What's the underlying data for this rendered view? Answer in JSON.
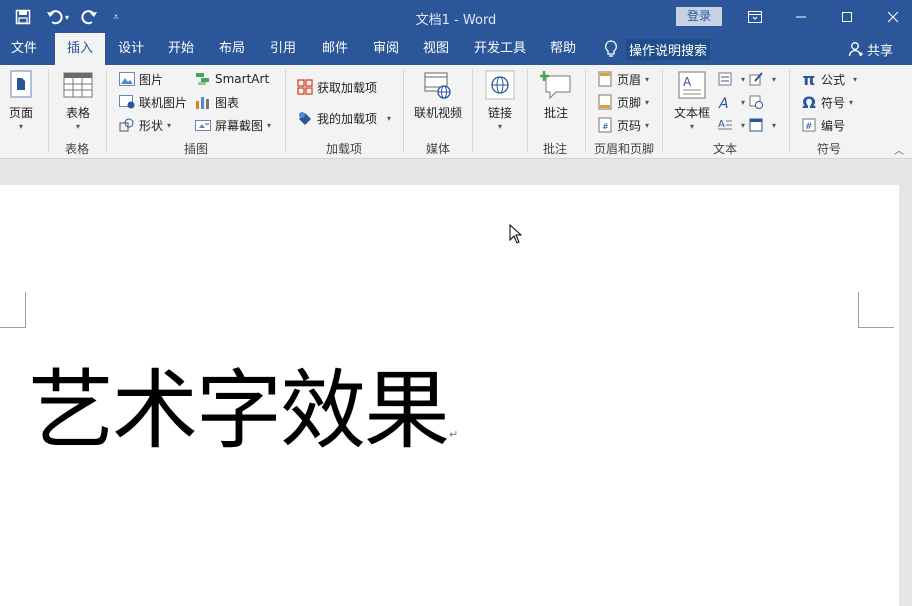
{
  "titlebar": {
    "title": "文档1  -  Word",
    "login": "登录",
    "colors": {
      "bg": "#2b579a"
    }
  },
  "tabs": [
    {
      "label": "文件"
    },
    {
      "label": "插入"
    },
    {
      "label": "设计"
    },
    {
      "label": "开始"
    },
    {
      "label": "布局"
    },
    {
      "label": "引用"
    },
    {
      "label": "邮件"
    },
    {
      "label": "审阅"
    },
    {
      "label": "视图"
    },
    {
      "label": "开发工具"
    },
    {
      "label": "帮助"
    }
  ],
  "tellme": {
    "label": "操作说明搜索"
  },
  "share": {
    "label": "共享"
  },
  "ribbon": {
    "pages": {
      "label": "页面",
      "group": ""
    },
    "tables": {
      "label": "表格",
      "group": "表格"
    },
    "illustrations": {
      "group": "插图",
      "picture": "图片",
      "online_picture": "联机图片",
      "shapes": "形状",
      "smartart": "SmartArt",
      "chart": "图表",
      "screenshot": "屏幕截图"
    },
    "addins": {
      "group": "加载项",
      "get": "获取加载项",
      "my": "我的加载项"
    },
    "media": {
      "label": "联机视频",
      "group": "媒体"
    },
    "links": {
      "label": "链接",
      "group": ""
    },
    "comments": {
      "label": "批注",
      "group": "批注"
    },
    "header_footer": {
      "group": "页眉和页脚",
      "header": "页眉",
      "footer": "页脚",
      "page_number": "页码"
    },
    "text": {
      "group": "文本",
      "textbox": "文本框"
    },
    "symbols": {
      "group": "符号",
      "equation": "公式",
      "symbol": "符号",
      "numbering": "编号"
    }
  },
  "document": {
    "text": "艺术字效果",
    "paragraph_mark": "↵"
  }
}
